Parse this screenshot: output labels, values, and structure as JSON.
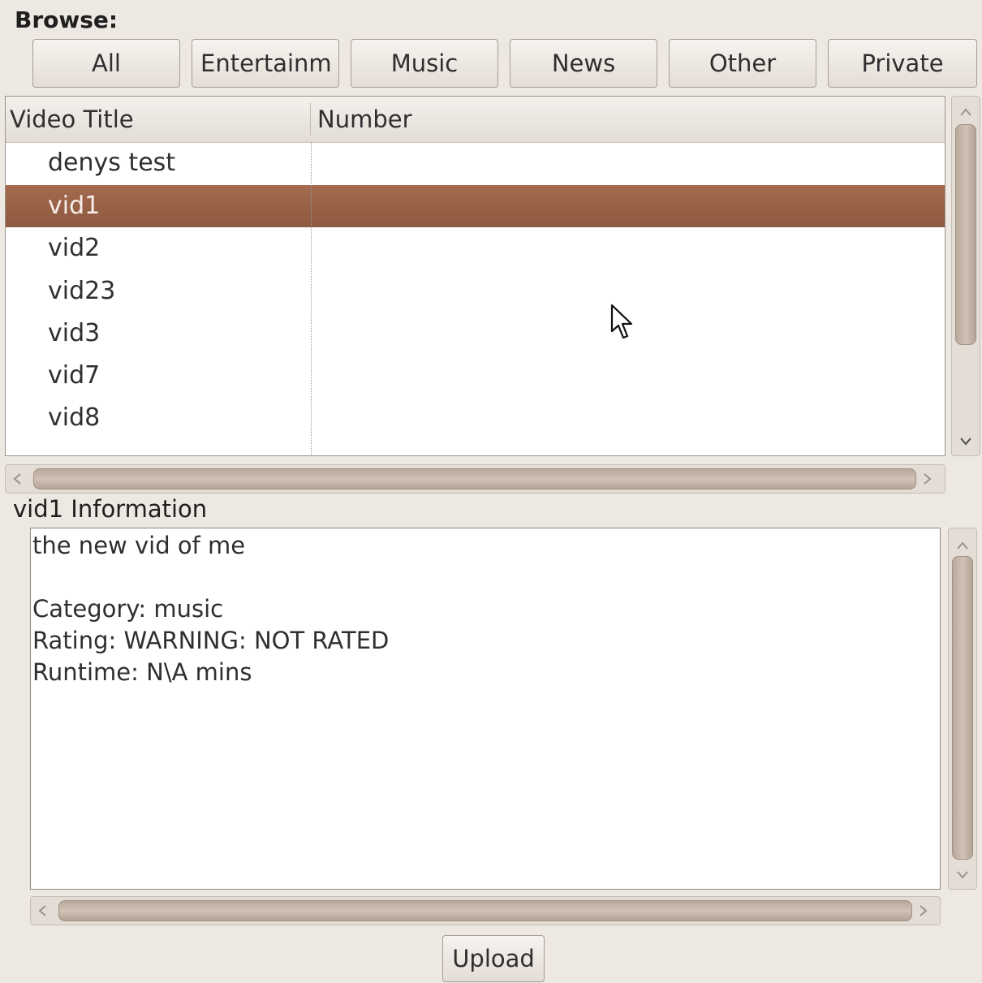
{
  "browse": {
    "label": "Browse:",
    "categories": [
      "All",
      "Entertainm",
      "Music",
      "News",
      "Other",
      "Private"
    ]
  },
  "video_list": {
    "columns": [
      "Video Title",
      "Number"
    ],
    "rows": [
      "denys test",
      "vid1",
      "vid2",
      "vid23",
      "vid3",
      "vid7",
      "vid8"
    ],
    "selected": "vid1"
  },
  "info": {
    "title": "vid1 Information",
    "lines": [
      "the new vid of me",
      "",
      "Category: music",
      "Rating: WARNING: NOT RATED",
      "Runtime: N\\A mins"
    ]
  },
  "upload_label": "Upload",
  "icons": {
    "scroll_up": "chevron-up-icon",
    "scroll_down": "chevron-down-icon",
    "scroll_left": "chevron-left-icon",
    "scroll_right": "chevron-right-icon",
    "cursor": "mouse-pointer-icon"
  },
  "colors": {
    "selection": "#96603f",
    "window_bg": "#ede8e2"
  }
}
